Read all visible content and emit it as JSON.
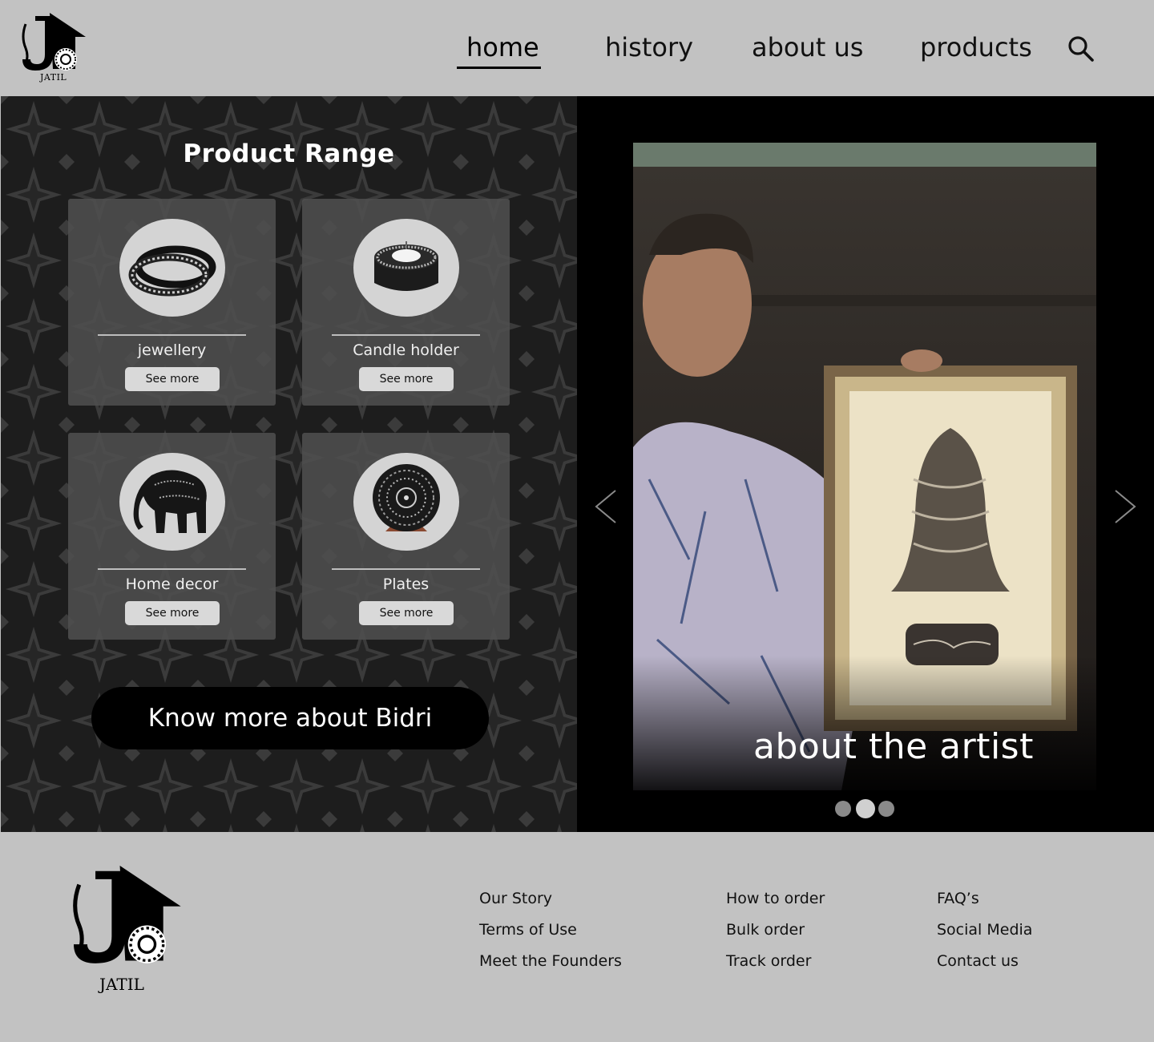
{
  "brand": {
    "name": "JATIL"
  },
  "nav": {
    "items": [
      {
        "label": "home",
        "active": true
      },
      {
        "label": "history"
      },
      {
        "label": "about us"
      },
      {
        "label": "products"
      }
    ],
    "search_icon": "search-icon"
  },
  "products": {
    "title": "Product  Range",
    "cards": [
      {
        "name": "jewellery",
        "button": "See more",
        "image": "bangles"
      },
      {
        "name": "Candle holder",
        "button": "See more",
        "image": "candle-holder"
      },
      {
        "name": "Home decor",
        "button": "See more",
        "image": "elephant"
      },
      {
        "name": "Plates",
        "button": "See more",
        "image": "plate"
      }
    ],
    "cta": "Know more about Bidri"
  },
  "carousel": {
    "caption": "about the artist",
    "slide_count": 3,
    "active_index": 1,
    "prev_icon": "chevron-left-icon",
    "next_icon": "chevron-right-icon"
  },
  "footer": {
    "columns": [
      [
        "Our Story",
        "Terms of Use",
        "Meet the Founders"
      ],
      [
        "How to order",
        "Bulk order",
        "Track order"
      ],
      [
        "FAQ’s",
        "Social Media",
        "Contact us"
      ]
    ]
  },
  "colors": {
    "chrome": "#c2c2c2",
    "panel_dark": "#1d1d1d",
    "card": "#505050",
    "button_light": "#d9d9d9",
    "text_light": "#ffffff"
  }
}
